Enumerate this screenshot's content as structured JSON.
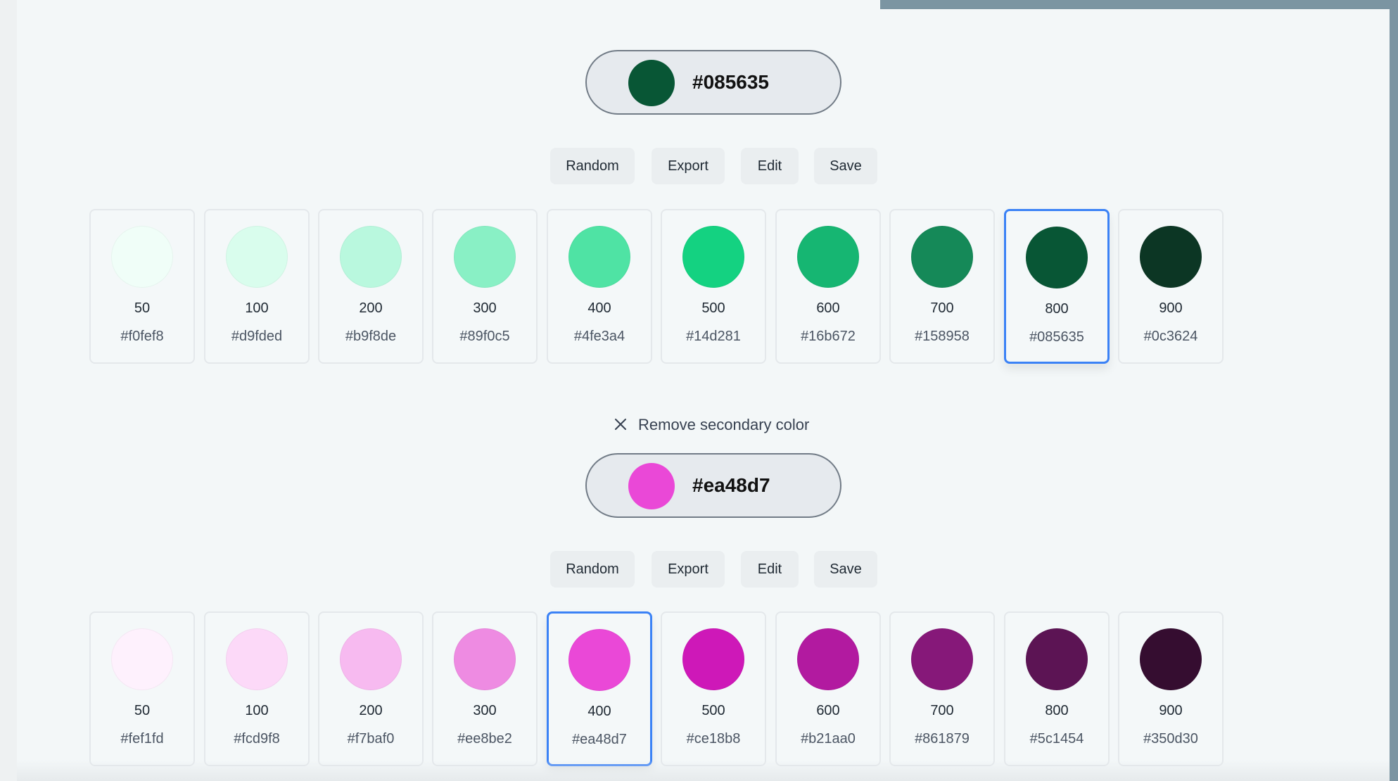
{
  "primary": {
    "hex": "#085635",
    "swatch_color": "#085635",
    "actions": {
      "random": "Random",
      "export": "Export",
      "edit": "Edit",
      "save": "Save"
    },
    "selected_index": 8,
    "shades": [
      {
        "weight": "50",
        "hex": "#f0fef8"
      },
      {
        "weight": "100",
        "hex": "#d9fded"
      },
      {
        "weight": "200",
        "hex": "#b9f8de"
      },
      {
        "weight": "300",
        "hex": "#89f0c5"
      },
      {
        "weight": "400",
        "hex": "#4fe3a4"
      },
      {
        "weight": "500",
        "hex": "#14d281"
      },
      {
        "weight": "600",
        "hex": "#16b672"
      },
      {
        "weight": "700",
        "hex": "#158958"
      },
      {
        "weight": "800",
        "hex": "#085635"
      },
      {
        "weight": "900",
        "hex": "#0c3624"
      }
    ]
  },
  "remove_secondary": {
    "label": "Remove secondary color",
    "icon": "close-icon"
  },
  "secondary": {
    "hex": "#ea48d7",
    "swatch_color": "#ea48d7",
    "actions": {
      "random": "Random",
      "export": "Export",
      "edit": "Edit",
      "save": "Save"
    },
    "selected_index": 4,
    "shades": [
      {
        "weight": "50",
        "hex": "#fef1fd"
      },
      {
        "weight": "100",
        "hex": "#fcd9f8"
      },
      {
        "weight": "200",
        "hex": "#f7baf0"
      },
      {
        "weight": "300",
        "hex": "#ee8be2"
      },
      {
        "weight": "400",
        "hex": "#ea48d7"
      },
      {
        "weight": "500",
        "hex": "#ce18b8"
      },
      {
        "weight": "600",
        "hex": "#b21aa0"
      },
      {
        "weight": "700",
        "hex": "#861879"
      },
      {
        "weight": "800",
        "hex": "#5c1454"
      },
      {
        "weight": "900",
        "hex": "#350d30"
      }
    ]
  },
  "colors": {
    "selected_border": "#3b82f6",
    "page_background": "#f3f7f8",
    "button_background": "#eaeef0"
  }
}
